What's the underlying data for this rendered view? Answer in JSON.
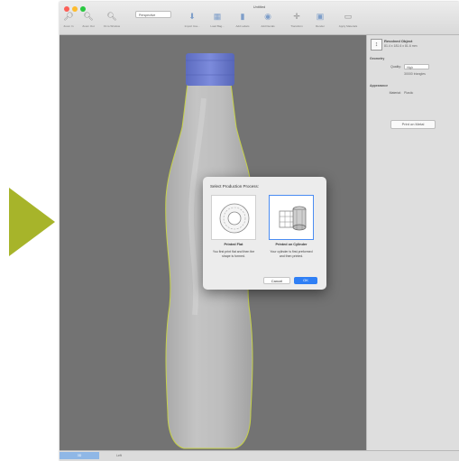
{
  "window": {
    "title": "Untitled"
  },
  "toolbar": {
    "items": [
      {
        "label": "Zoom In",
        "icon": "zoom-in-icon"
      },
      {
        "label": "Zoom Out",
        "icon": "zoom-out-icon"
      },
      {
        "label": "Fit to Window",
        "icon": "zoom-fit-icon"
      },
      {
        "label": "Import Ima...",
        "icon": "import-image-icon"
      },
      {
        "label": "Load Bag...",
        "icon": "load-icon"
      },
      {
        "label": "Add Labels",
        "icon": "labels-icon"
      },
      {
        "label": "Add Decals",
        "icon": "decals-icon"
      },
      {
        "label": "Transform",
        "icon": "transform-icon"
      },
      {
        "label": "Render",
        "icon": "render-icon"
      },
      {
        "label": "Apply Materials",
        "icon": "materials-icon"
      }
    ],
    "view_select": "Perspective"
  },
  "inspector": {
    "object_title": "Revolved Object",
    "object_size": "81.4 x 181.6 x 81.6 mm",
    "geometry_header": "Geometry",
    "quality_label": "Quality:",
    "quality_value": "High",
    "triangles": "30000 triangles",
    "appearance_header": "Appearance",
    "material_label": "Material:",
    "material_value": "Plastic",
    "print_button": "Print on Metal"
  },
  "dialog": {
    "title": "Select Production Process:",
    "options": [
      {
        "label": "Printed Flat",
        "description": "You first print flat and then the shape is formed."
      },
      {
        "label": "Printed on Cylinder",
        "description": "Your cylinder is first preformed and then printed."
      }
    ],
    "cancel_label": "Cancel",
    "ok_label": "OK"
  },
  "bottom": {
    "seg1": "3D",
    "seg2": "Left"
  },
  "colors": {
    "accent": "#2f7ff5",
    "arrow": "#a7b42a",
    "cap": "#6f7fd0",
    "outline": "#c6d14a"
  }
}
